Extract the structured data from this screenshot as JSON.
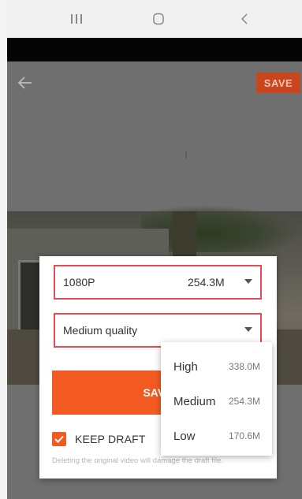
{
  "colors": {
    "accent": "#f25a22",
    "highlight_border": "#e64a55",
    "top_save_bg": "#c8451d"
  },
  "topbar": {
    "save_label": "SAVE"
  },
  "dialog": {
    "resolution": {
      "label": "1080P",
      "size": "254.3M"
    },
    "quality": {
      "label": "Medium quality"
    },
    "save_label": "SAVE",
    "keep_draft_label": "KEEP DRAFT",
    "keep_draft_checked": true,
    "warning": "Deleting the original video will damage the draft file."
  },
  "quality_menu": {
    "items": [
      {
        "name": "High",
        "size": "338.0M"
      },
      {
        "name": "Medium",
        "size": "254.3M"
      },
      {
        "name": "Low",
        "size": "170.6M"
      }
    ]
  },
  "icons": [
    "recent-apps-icon",
    "home-icon",
    "back-nav-icon",
    "back-arrow-icon",
    "checkmark-icon",
    "chevron-down-icon"
  ]
}
